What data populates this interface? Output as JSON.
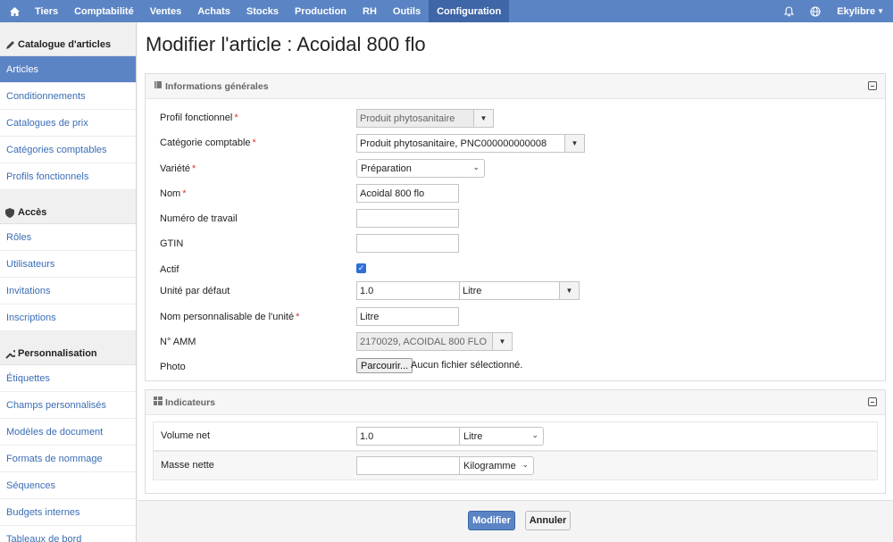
{
  "nav": {
    "items": [
      "Tiers",
      "Comptabilité",
      "Ventes",
      "Achats",
      "Stocks",
      "Production",
      "RH",
      "Outils",
      "Configuration"
    ],
    "active": "Configuration",
    "user": "Ekylibre"
  },
  "sidebar": {
    "sections": [
      {
        "title": "Catalogue d'articles",
        "icon": "pencil-icon",
        "items": [
          "Articles",
          "Conditionnements",
          "Catalogues de prix",
          "Catégories comptables",
          "Profils fonctionnels"
        ]
      },
      {
        "title": "Accès",
        "icon": "shield-icon",
        "items": [
          "Rôles",
          "Utilisateurs",
          "Invitations",
          "Inscriptions"
        ]
      },
      {
        "title": "Personnalisation",
        "icon": "wrench-icon",
        "items": [
          "Étiquettes",
          "Champs personnalisés",
          "Modèles de document",
          "Formats de nommage",
          "Séquences",
          "Budgets internes",
          "Tableaux de bord"
        ]
      }
    ],
    "active_item": "Articles"
  },
  "page": {
    "title": "Modifier l'article : Acoidal 800 flo"
  },
  "general": {
    "title": "Informations générales",
    "labels": {
      "profile": "Profil fonctionnel",
      "category": "Catégorie comptable",
      "variety": "Variété",
      "name": "Nom",
      "work_number": "Numéro de travail",
      "gtin": "GTIN",
      "active": "Actif",
      "default_unit": "Unité par défaut",
      "custom_unit_name": "Nom personnalisable de l'unité",
      "amm": "N° AMM",
      "photo": "Photo"
    },
    "required_mark": "*",
    "values": {
      "profile": "Produit phytosanitaire",
      "category": "Produit phytosanitaire, PNC000000000008",
      "variety": "Préparation",
      "name": "Acoidal 800 flo",
      "work_number": "",
      "gtin": "",
      "active": true,
      "default_unit_qty": "1.0",
      "default_unit": "Litre",
      "custom_unit_name": "Litre",
      "amm": "2170029, ACOIDAL 800 FLO",
      "photo_button": "Parcourir...",
      "photo_status": "Aucun fichier sélectionné."
    }
  },
  "indicators": {
    "title": "Indicateurs",
    "rows": [
      {
        "label": "Volume net",
        "value": "1.0",
        "unit": "Litre"
      },
      {
        "label": "Masse nette",
        "value": "",
        "unit": "Kilogramme"
      }
    ]
  },
  "actions": {
    "submit": "Modifier",
    "cancel": "Annuler"
  },
  "colors": {
    "accent": "#5b84c4",
    "accent_dark": "#3f66a6",
    "link": "#3a6db5",
    "required": "#dd3333"
  }
}
